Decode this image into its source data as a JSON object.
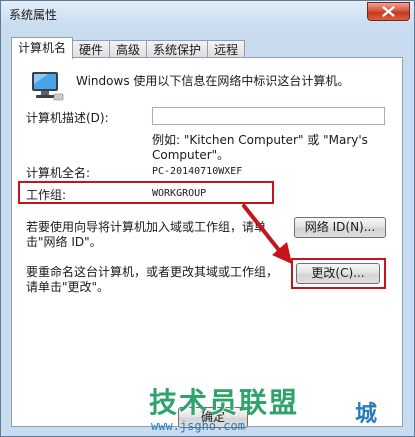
{
  "window": {
    "title": "系统属性"
  },
  "tabs": [
    {
      "label": "计算机名",
      "active": true
    },
    {
      "label": "硬件",
      "active": false
    },
    {
      "label": "高级",
      "active": false
    },
    {
      "label": "系统保护",
      "active": false
    },
    {
      "label": "远程",
      "active": false
    }
  ],
  "panel": {
    "intro_text": "Windows 使用以下信息在网络中标识这台计算机。",
    "description_label": "计算机描述(D):",
    "description_value": "",
    "example_line1": "例如: \"Kitchen Computer\" 或 \"Mary's",
    "example_line2": "Computer\"。",
    "fullname_label": "计算机全名:",
    "fullname_value": "PC-20140710WXEF",
    "workgroup_label": "工作组:",
    "workgroup_value": "WORKGROUP",
    "networkid_text_line1": "若要使用向导将计算机加入域或工作组，请单",
    "networkid_text_line2": "击\"网络 ID\"。",
    "networkid_button": "网络 ID(N)...",
    "change_text_line1": "要重命名这台计算机，或者更改其域或工作组，",
    "change_text_line2": "请单击\"更改\"。",
    "change_button": "更改(C)...",
    "ok_button": "确定"
  },
  "colors": {
    "highlight": "#c6141c",
    "window_frame": "#c9dcef"
  },
  "watermark": {
    "brand": "技术员联盟",
    "url": "www.jsgho.com",
    "city": "城"
  }
}
